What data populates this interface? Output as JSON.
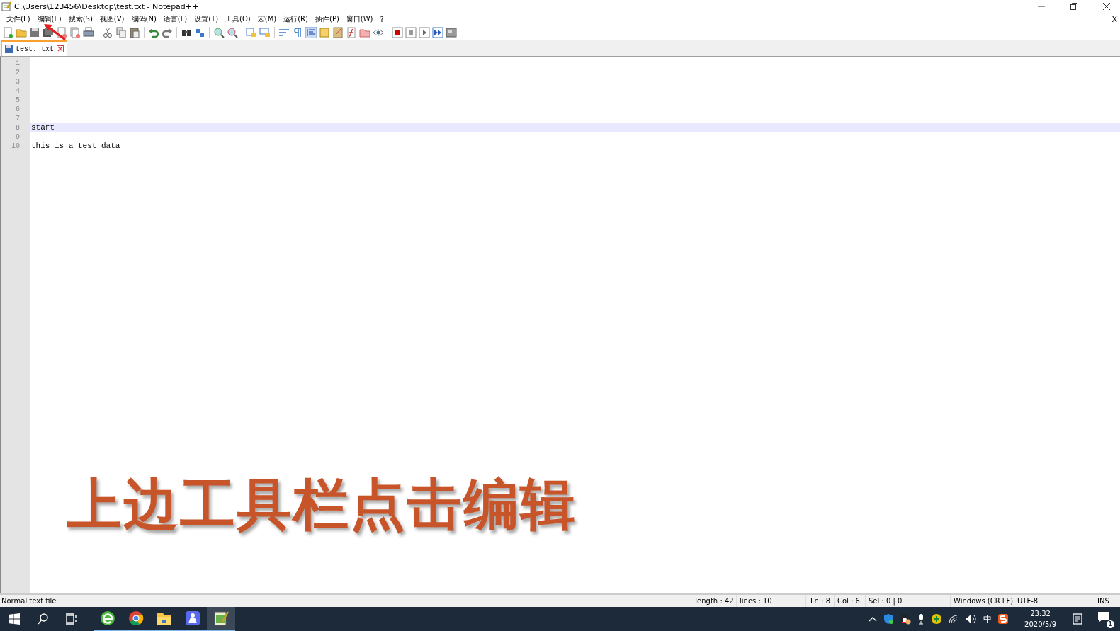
{
  "window": {
    "title": "C:\\Users\\123456\\Desktop\\test.txt - Notepad++"
  },
  "menu": [
    {
      "label": "文件(F)"
    },
    {
      "label": "编辑(E)"
    },
    {
      "label": "搜索(S)"
    },
    {
      "label": "视图(V)"
    },
    {
      "label": "编码(N)"
    },
    {
      "label": "语言(L)"
    },
    {
      "label": "设置(T)"
    },
    {
      "label": "工具(O)"
    },
    {
      "label": "宏(M)"
    },
    {
      "label": "运行(R)"
    },
    {
      "label": "插件(P)"
    },
    {
      "label": "窗口(W)"
    },
    {
      "label": "?"
    }
  ],
  "menu_close": "X",
  "tabs": [
    {
      "label": "test. txt",
      "selected": true
    }
  ],
  "editor": {
    "lines": [
      {
        "number": "1",
        "current": false
      },
      {
        "number": "2",
        "current": false
      },
      {
        "number": "3",
        "current": false
      },
      {
        "number": "4",
        "current": false
      },
      {
        "number": "5",
        "current": false
      },
      {
        "number": "6",
        "current": false
      },
      {
        "number": "7",
        "current": false
      },
      {
        "number": "8",
        "text": "start",
        "current": true
      },
      {
        "number": "9",
        "current": false
      },
      {
        "number": "10",
        "text": "this is a test data",
        "current": false
      }
    ]
  },
  "caption": "上边工具栏点击编辑",
  "status_bar": {
    "file_type": "Normal text file",
    "length": "length : 42",
    "lines": "lines : 10",
    "ln": "Ln : 8",
    "col": "Col : 6",
    "sel": "Sel : 0 | 0",
    "eol": "Windows (CR LF)",
    "encoding": "UTF-8",
    "mode": "INS"
  },
  "taskbar": {
    "apps": [
      {
        "kind": "ie",
        "running": true,
        "active": false
      },
      {
        "kind": "chrome",
        "running": true,
        "active": false
      },
      {
        "kind": "folder",
        "running": true,
        "active": false
      },
      {
        "kind": "app",
        "running": true,
        "active": false
      },
      {
        "kind": "notepad",
        "running": true,
        "active": true
      }
    ],
    "ime": "中",
    "time": "23:32",
    "date": "2020/5/9",
    "notifications": "1"
  }
}
